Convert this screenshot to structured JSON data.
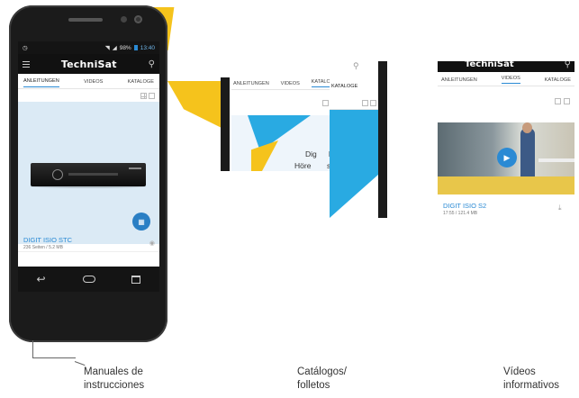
{
  "main_phone": {
    "status": {
      "left_icon": "alarm-icon",
      "battery_pct": "98%",
      "time": "13:40"
    },
    "appbar": {
      "brand": "TechniSat"
    },
    "tabs": [
      "ANLEITUNGEN",
      "VIDEOS",
      "KATALOGE"
    ],
    "item": {
      "title": "DIGIT ISIO STC",
      "meta": "236 Seiten / 5.2 MB"
    },
    "fab_icon": "qr-code-icon",
    "nav": {
      "back": "↩",
      "home": "",
      "recents": ""
    }
  },
  "catalog_screen": {
    "tabs": [
      "ANLEITUNGEN",
      "VIDEOS",
      "KATALOGE"
    ],
    "headline_1": "Dig",
    "headline_1b": "ler",
    "headline_2": "Höre",
    "headline_2b": "ss."
  },
  "video_screen": {
    "brand": "TechniSat",
    "tabs": [
      "ANLEITUNGEN",
      "VIDEOS",
      "KATALOGE"
    ],
    "item": {
      "title": "DIGIT ISIO S2",
      "meta": "17:55 / 121.4 MB"
    }
  },
  "captions": {
    "manuals": [
      "Manuales de",
      "instrucciones"
    ],
    "catalogs": [
      "Catálogos/",
      "folletos"
    ],
    "videos": [
      "Vídeos",
      "informativos"
    ]
  },
  "colors": {
    "accent_blue": "#2a8ad4",
    "yellow": "#f5c31c",
    "cyan": "#29aae2",
    "light_blue_bg": "#dbeaf5"
  }
}
